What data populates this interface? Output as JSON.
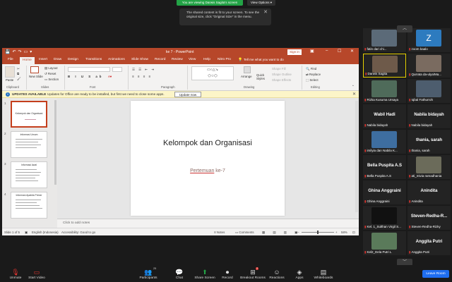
{
  "zoom": {
    "viewing_banner": "You are viewing Darwis Sagita's screen",
    "view_options": "View Options ▾",
    "notice": "The shared content is fit to your screen. To see the original size, click \"Original Size\" in the menu.",
    "participants_count": "25",
    "reactions_badge": "2",
    "toolbar": [
      {
        "label": "Unmute",
        "icon": "🎙"
      },
      {
        "label": "Start Video",
        "icon": "▭"
      },
      {
        "label": "Participants",
        "icon": "👥"
      },
      {
        "label": "Chat",
        "icon": "💬"
      },
      {
        "label": "Share Screen",
        "icon": "⬆"
      },
      {
        "label": "Record",
        "icon": "⏺"
      },
      {
        "label": "Breakout Rooms",
        "icon": "⊞"
      },
      {
        "label": "Reactions",
        "icon": "☺"
      },
      {
        "label": "Apps",
        "icon": "◈"
      },
      {
        "label": "Whiteboards",
        "icon": "▤"
      }
    ],
    "leave_label": "Leave Room",
    "tiles": [
      {
        "name": "fatin dari chi...",
        "big": "",
        "color": "#5b6a78"
      },
      {
        "name": "zoom baalo",
        "big": "Z",
        "color": "#2d7bbf"
      },
      {
        "name": "Darwis Sagita",
        "big": "",
        "color": "#6e5a4a"
      },
      {
        "name": "Qurrata da-ulya/Ma...",
        "big": "",
        "color": "#7a6b60"
      },
      {
        "name": "Rizka Kusuma Ursaya",
        "big": "",
        "color": "#4f6b5a"
      },
      {
        "name": "Iqbal Fathurroh",
        "big": "",
        "color": "#4d5d6e"
      },
      {
        "name": "Nabila bidayah",
        "big": "Wabil Hadi",
        "color": ""
      },
      {
        "name": "Nabila bidayah",
        "big": "Nabila bidayah",
        "color": ""
      },
      {
        "name": "imilyia dan Nabila K...",
        "big": "",
        "color": "#3e6ea0"
      },
      {
        "name": "thania, sarah",
        "big": "thania, sarah",
        "color": ""
      },
      {
        "name": "Bella Puspita A.S",
        "big": "Bella Puspita A.S",
        "color": ""
      },
      {
        "name": "ati_mivia ramadhania",
        "big": "",
        "color": "#6b6b5a"
      },
      {
        "name": "Ghina Anggraini",
        "big": "Ghina Anggraini",
        "color": ""
      },
      {
        "name": "Anindita",
        "big": "Anindita",
        "color": ""
      },
      {
        "name": "Kel. 1_Sulthan Virgil S...",
        "big": "",
        "color": "#111"
      },
      {
        "name": "Steven-Redha-Rizky",
        "big": "Steven-Redha-R...",
        "color": ""
      },
      {
        "name": "Kel2_Dela Putri L",
        "big": "",
        "color": "#5a7a5a"
      },
      {
        "name": "Anggita Putri",
        "big": "Anggita Putri",
        "color": ""
      }
    ]
  },
  "ppt": {
    "doc_title": "ke 7  -  PowerPoint",
    "sign_in": "Sign in",
    "tabs": [
      "File",
      "Home",
      "Insert",
      "Draw",
      "Design",
      "Transitions",
      "Animations",
      "Slide Show",
      "Record",
      "Review",
      "View",
      "Help",
      "Nitro Pro"
    ],
    "tell_me": "Tell me what you want to do",
    "ribbon": {
      "paste": "Paste",
      "clipboard": "Clipboard",
      "new_slide": "New Slide",
      "layout": "Layout",
      "reset": "Reset",
      "section": "Section",
      "slides": "Slides",
      "font": "Font",
      "paragraph": "Paragraph",
      "arrange": "Arrange",
      "quick_styles": "Quick Styles",
      "shape_fill": "Shape Fill",
      "shape_outline": "Shape Outline",
      "shape_effects": "Shape Effects",
      "drawing": "Drawing",
      "find": "Find",
      "replace": "Replace",
      "select": "Select",
      "editing": "Editing"
    },
    "info": {
      "title": "UPDATES AVAILABLE",
      "message": "Updates for Office are ready to be installed, but first we need to close some apps.",
      "button": "Update now"
    },
    "thumbnails": [
      {
        "num": "1",
        "title": "Kelompok dan Organisasi"
      },
      {
        "num": "2",
        "title": "Informasi Umum"
      },
      {
        "num": "3",
        "title": "Informasi Awal"
      },
      {
        "num": "4",
        "title": "Informasi Apabila Primer"
      }
    ],
    "slide": {
      "title": "Kelompok dan Organisasi",
      "subtitle_underlined": "Pertemuan",
      "subtitle_rest": " ke-7"
    },
    "notes_placeholder": "Click to add notes",
    "status": {
      "slide_of": "Slide 1 of 5",
      "language": "English (Indonesia)",
      "accessibility": "Accessibility: Good to go",
      "notes": "Notes",
      "comments": "Comments",
      "zoom": "58%"
    }
  }
}
